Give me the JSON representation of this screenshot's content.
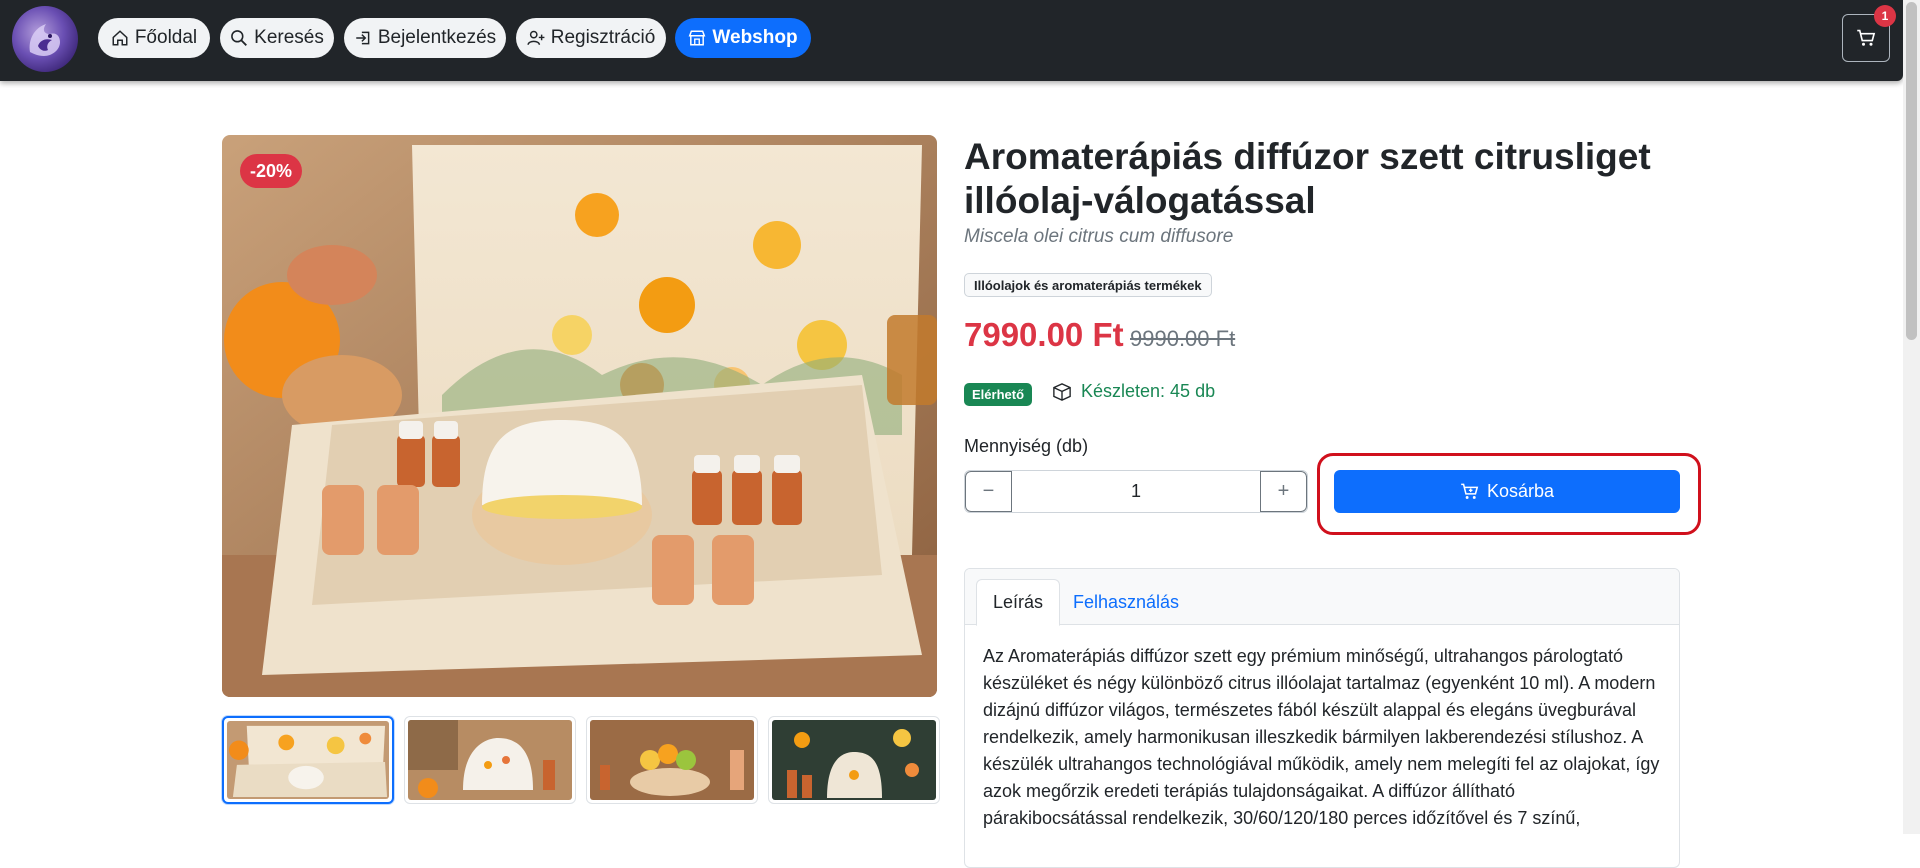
{
  "navbar": {
    "items": [
      {
        "label": "Főoldal",
        "icon": "home-icon"
      },
      {
        "label": "Keresés",
        "icon": "search-icon"
      },
      {
        "label": "Bejelentkezés",
        "icon": "login-icon"
      },
      {
        "label": "Regisztráció",
        "icon": "user-plus-icon"
      },
      {
        "label": "Webshop",
        "icon": "shop-icon",
        "active": true
      }
    ],
    "cart_count": "1",
    "accent_color": "#0d6efd"
  },
  "product": {
    "discount_badge": "-20%",
    "title": "Aromaterápiás diffúzor szett citrusliget illóolaj-válogatással",
    "latin_name": "Miscela olei citrus cum diffusore",
    "category": "Illóolajok és aromaterápiás termékek",
    "price": "7990.00 Ft",
    "old_price": "9990.00 Ft",
    "availability": "Elérhető",
    "stock": "Készleten: 45 db",
    "quantity_label": "Mennyiség (db)",
    "quantity": "1",
    "minus": "−",
    "plus": "+",
    "add_to_cart": "Kosárba",
    "price_color": "#dc3545",
    "stock_color": "#198754"
  },
  "tabs": [
    {
      "label": "Leírás",
      "active": true
    },
    {
      "label": "Felhasználás",
      "active": false
    }
  ],
  "description_lines": [
    "Az Aromaterápiás diffúzor szett egy prémium minőségű, ultrahangos párologtató",
    "készüléket és négy különböző citrus illóolajat tartalmaz (egyenként 10 ml). A modern",
    "dizájnú diffúzor világos, természetes fából készült alappal és elegáns üvegburával",
    "rendelkezik, amely harmonikusan illeszkedik bármilyen lakberendezési stílushoz. A",
    "készülék ultrahangos technológiával működik, amely nem melegíti fel az olajokat, így",
    "azok megőrzik eredeti terápiás tulajdonságaikat. A diffúzor állítható",
    "párakibocsátással rendelkezik, 30/60/120/180 perces időzítővel és 7 színű,"
  ]
}
